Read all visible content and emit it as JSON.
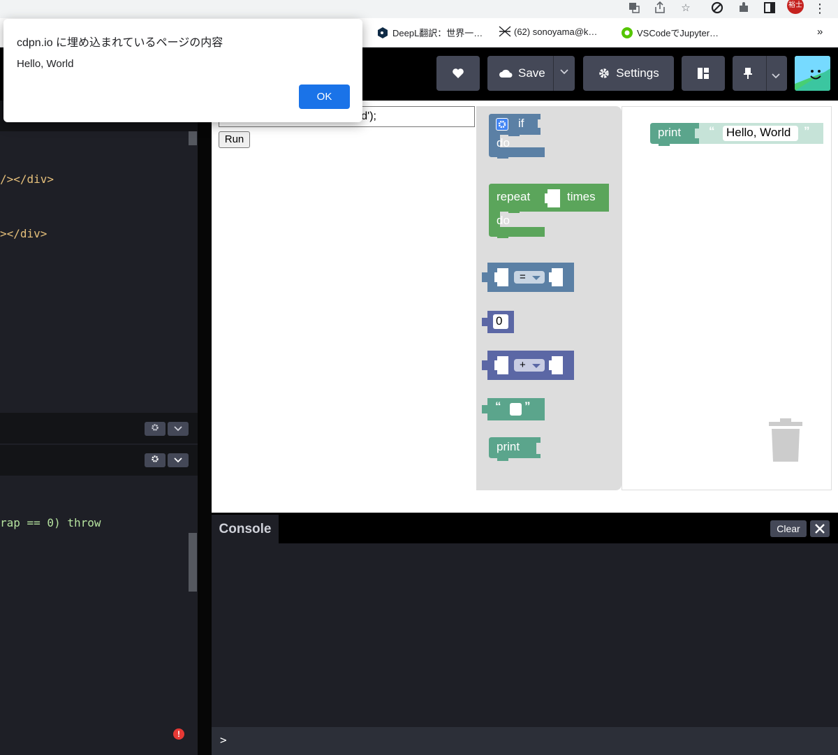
{
  "bookmarks": [
    {
      "label": "DeepL翻訳：世界一…"
    },
    {
      "label": "(62) sonoyama@k…"
    },
    {
      "label": "VSCodeでJupyter…"
    }
  ],
  "bookmarks_more": "»",
  "profile_initials": "裕士",
  "alert": {
    "title": "cdpn.io に埋め込まれているページの内容",
    "message": "Hello, World",
    "ok_label": "OK"
  },
  "header": {
    "save_label": "Save",
    "settings_label": "Settings"
  },
  "editor": {
    "lines": [
      {
        "text": "/></div>",
        "color": "#e6c07b"
      },
      {
        "text": "></div>",
        "color": "#e6c07b"
      },
      {
        "text": "rap == 0) throw",
        "color": "#b7e4a0"
      }
    ]
  },
  "preview": {
    "code_input_value": "d');",
    "run_label": "Run"
  },
  "flyout": {
    "if_label": "if",
    "do_label": "do",
    "repeat_label": "repeat",
    "times_label": "times",
    "repeat_do_label": "do",
    "compare_op": "=",
    "number_value": "0",
    "arith_op": "+",
    "quote_open": "“",
    "quote_close": "”",
    "print_label": "print"
  },
  "workspace": {
    "print_label": "print",
    "string_value": "Hello, World",
    "quote_open": "“",
    "quote_close": "”"
  },
  "console": {
    "tab_label": "Console",
    "clear_label": "Clear",
    "prompt": ">"
  },
  "colors": {
    "logic_block": "#5b80a5",
    "loop_block": "#5ba55b",
    "math_block": "#5b67a5",
    "text_block": "#5ba58c",
    "codepen_btn": "#444857",
    "ok_button": "#1a73e8",
    "error_badge": "#e53935"
  }
}
